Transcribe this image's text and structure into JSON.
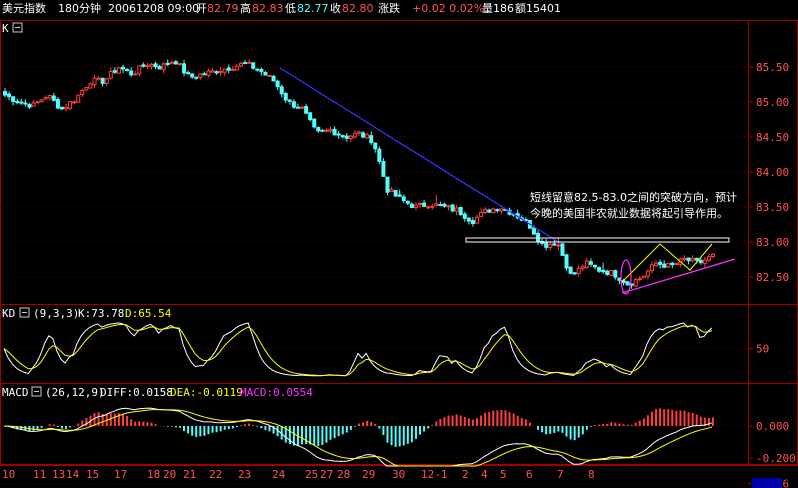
{
  "header": {
    "title": "美元指数",
    "period": "180分钟",
    "datetime": "20061208 09:00",
    "open_label": "开",
    "open_value": "82.79",
    "high_label": "高",
    "high_value": "82.83",
    "low_label": "低",
    "low_value": "82.77",
    "close_label": "收",
    "close_value": "82.80",
    "change_label": "涨跌",
    "change_value": "+0.02 0.02%",
    "volume": "量186",
    "amount": "额15401"
  },
  "main_panel": {
    "label": "K",
    "annotation_line1": "短线留意82.5-83.0之间的突破方向，预计",
    "annotation_line2": "今晚的美国非农就业数据将起引导作用。"
  },
  "kd_panel": {
    "label": "KD",
    "params": "(9,3,3)",
    "k_text": "K:73.78",
    "d_text": "D:65.54"
  },
  "macd_panel": {
    "label": "MACD",
    "params": "(26,12,9)",
    "diff_text": "DIFF:0.0158",
    "dea_text": "DEA:-0.0119",
    "macd_text": "MACD:0.0554"
  },
  "chart_data": [
    {
      "type": "candlestick",
      "ylim": [
        82.2,
        85.9
      ],
      "yticks": [
        "85.50",
        "85.00",
        "84.50",
        "84.00",
        "83.50",
        "83.00",
        "82.50"
      ],
      "ytick_values": [
        85.5,
        85.0,
        84.5,
        84.0,
        83.5,
        83.0,
        82.5
      ],
      "xtick_labels": [
        "10",
        "11",
        "13",
        "14",
        "15",
        "17",
        "18",
        "20",
        "21",
        "22",
        "23",
        "24",
        "25",
        "27",
        "28",
        "29",
        "30",
        "12-1",
        "2",
        "4",
        "5",
        "6",
        "7",
        "8"
      ],
      "close_path": [
        85.1,
        85.0,
        84.95,
        85.1,
        84.9,
        85.05,
        85.3,
        85.3,
        85.5,
        85.4,
        85.55,
        85.5,
        85.6,
        85.35,
        85.4,
        85.45,
        85.5,
        85.55,
        85.45,
        85.3,
        85.0,
        84.9,
        84.55,
        84.6,
        84.5,
        84.55,
        84.45,
        83.75,
        83.6,
        83.5,
        83.55,
        83.5,
        83.45,
        83.3,
        83.45,
        83.5,
        83.4,
        83.25,
        82.95,
        83.0,
        82.5,
        82.7,
        82.6,
        82.55,
        82.4,
        82.5,
        82.7,
        82.65,
        82.75,
        82.7,
        82.8
      ],
      "resistance_line": 83.0,
      "colors": {
        "up": "#ff3f3f",
        "down": "#54fcfc",
        "trendline": "#3333ff",
        "support_line": "#ff33ff",
        "triangle": "#ffff00",
        "ellipse": "#ff33ff",
        "level_line": "#ffffff"
      }
    },
    {
      "type": "line",
      "name_k": "K",
      "name_d": "D",
      "ytick": "50",
      "last_k": 73.78,
      "last_d": 65.54
    },
    {
      "type": "bar",
      "yticks": [
        "0.000",
        "-0.200",
        "-0.36"
      ],
      "ytick_values": [
        0.0,
        -0.2,
        -0.36
      ],
      "last_diff": 0.0158,
      "last_dea": -0.0119,
      "last_macd": 0.0554
    }
  ]
}
